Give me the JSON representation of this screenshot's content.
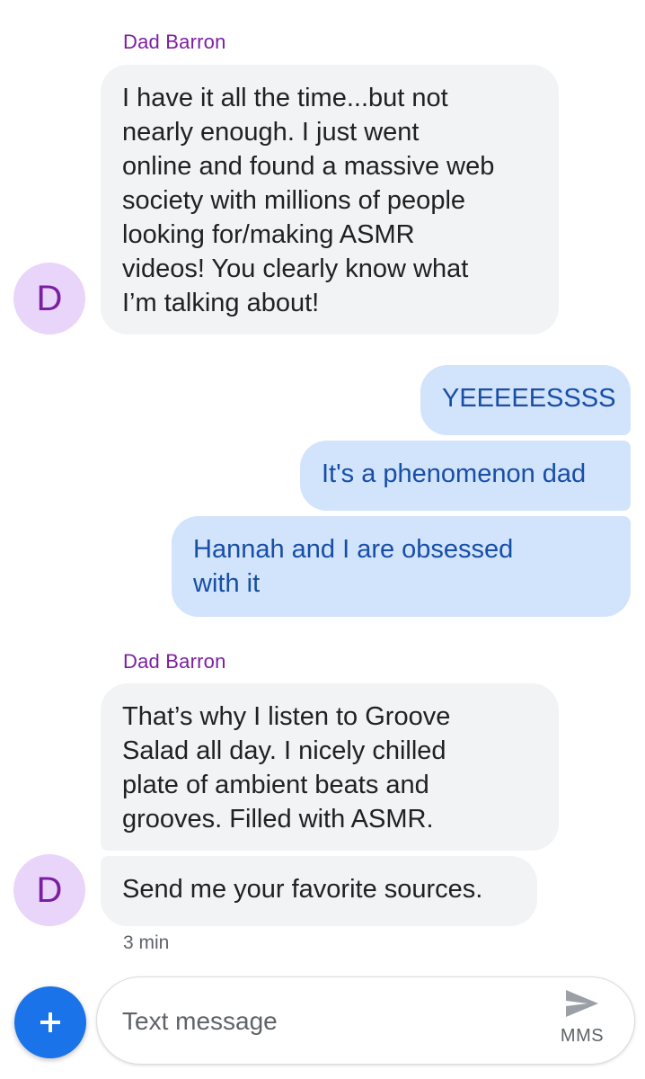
{
  "conversation": {
    "sender_name": "Dad Barron",
    "avatar_letter": "D",
    "groups": [
      {
        "sender": "Dad Barron",
        "messages": [
          "I have it all the time...but not\nnearly enough.  I just went\nonline and found a massive web\nsociety with millions of people\nlooking for/making ASMR\nvideos!  You clearly know what\nI’m talking about!"
        ]
      },
      {
        "sender": "me",
        "messages": [
          "YEEEEESSSS",
          "It's a phenomenon dad",
          "Hannah and I are obsessed\nwith it"
        ]
      },
      {
        "sender": "Dad Barron",
        "messages": [
          "That’s why I listen to Groove\nSalad all day.  I nicely chilled\nplate of ambient beats and\ngrooves.  Filled with ASMR.",
          "Send me your favorite sources."
        ]
      }
    ],
    "timestamp": "3 min"
  },
  "composer": {
    "placeholder": "Text message",
    "send_type_label": "MMS",
    "add_button_icon": "plus-icon",
    "send_icon": "send-icon"
  },
  "colors": {
    "sender_name": "#7b1fa2",
    "avatar_bg": "#e9d4fa",
    "incoming_bubble": "#f1f3f4",
    "outgoing_bubble": "#d2e3fc",
    "outgoing_text": "#174ea6",
    "fab": "#1a73e8"
  }
}
